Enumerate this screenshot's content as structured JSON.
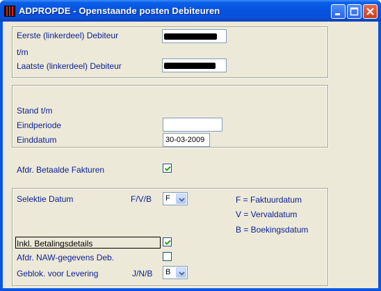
{
  "window": {
    "title": "ADPROPDE - Openstaande posten Debiteuren"
  },
  "group1": {
    "eerste_label": "Eerste  (linkerdeel) Debiteur",
    "tm_label": "t/m",
    "laatste_label": "Laatste (linkerdeel) Debiteur"
  },
  "group2": {
    "stand_label": "Stand t/m",
    "eindperiode_label": "Eindperiode",
    "eindperiode_value": "",
    "einddatum_label": "Einddatum",
    "einddatum_value": "30-03-2009"
  },
  "betaalde": {
    "label": "Afdr. Betaalde Fakturen",
    "checked": true
  },
  "group3": {
    "selektie_label": "Selektie Datum",
    "selektie_options_label": "F/V/B",
    "selektie_value": "F",
    "legend": [
      "F = Faktuurdatum",
      "V = Vervaldatum",
      "B = Boekingsdatum"
    ],
    "betalingsdetails_label": "Inkl. Betalingsdetails",
    "betalingsdetails_checked": true,
    "naw_label": "Afdr. NAW-gegevens Deb.",
    "naw_checked": false,
    "geblok_label": "Geblok. voor Levering",
    "geblok_options_label": "J/N/B",
    "geblok_value": "B"
  }
}
